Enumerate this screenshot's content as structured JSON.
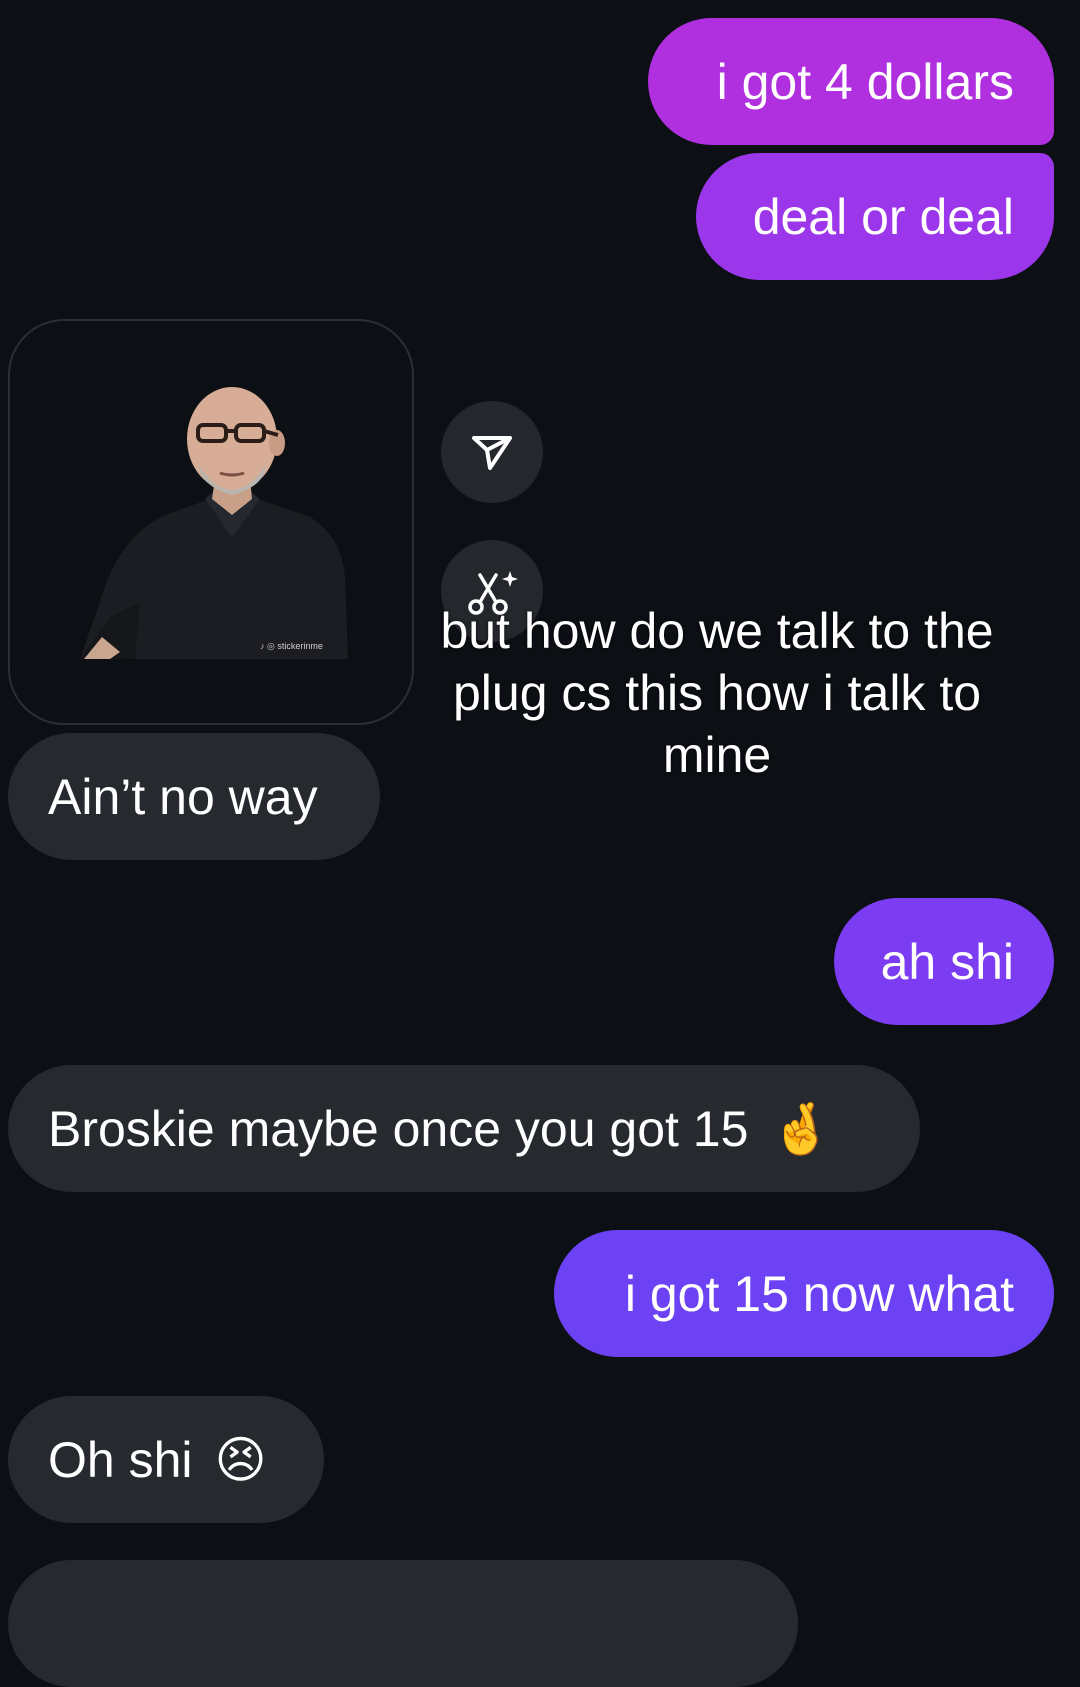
{
  "messages": [
    {
      "id": "b1",
      "sender": "me",
      "text": "i got 4 dollars"
    },
    {
      "id": "b2",
      "sender": "me",
      "text": "deal or deal"
    },
    {
      "id": "sticker",
      "sender": "them",
      "type": "sticker",
      "watermark": "stickerinme"
    },
    {
      "id": "b3",
      "sender": "them",
      "text": "Ain’t no way"
    },
    {
      "id": "b4",
      "sender": "me",
      "text": "ah shi"
    },
    {
      "id": "b5",
      "sender": "them",
      "text": "Broskie maybe once you got 15",
      "emoji": "🤞"
    },
    {
      "id": "b6",
      "sender": "me",
      "text": "i got 15 now what"
    },
    {
      "id": "b7",
      "sender": "them",
      "text": "Oh shi",
      "emoji": "😣"
    }
  ],
  "overlay_caption": "but how do we talk to the plug cs this how i talk to mine",
  "actions": {
    "share_icon": "paper-plane-icon",
    "cutout_icon": "scissors-sparkle-icon"
  },
  "colors": {
    "background": "#0c0f14",
    "received_bubble": "#262a2f",
    "sent_gradient_top": "#b02fdf",
    "sent_gradient_bottom": "#6c42f4"
  }
}
